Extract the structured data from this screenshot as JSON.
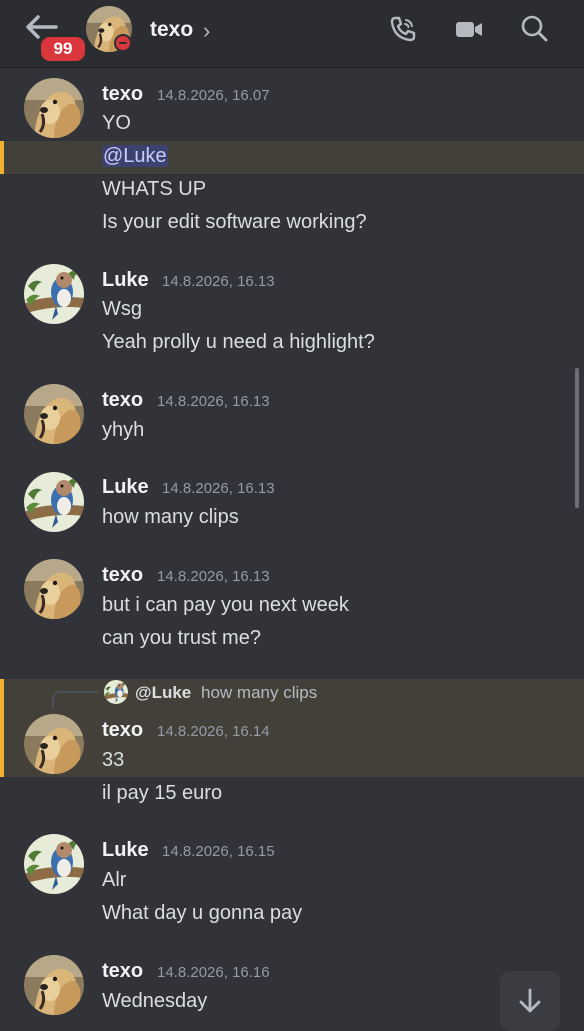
{
  "header": {
    "title": "texo",
    "chevron": "›",
    "unread_badge": "99",
    "status": "do-not-disturb",
    "icons": [
      "back-arrow-icon",
      "call-icon",
      "video-icon",
      "search-icon"
    ]
  },
  "colors": {
    "background": "#313338",
    "header": "#2b2d31",
    "highlight": "#43403a",
    "highlight_bar": "#f0b232",
    "badge": "#da373c"
  },
  "messages": [
    {
      "author": "texo",
      "time": "14.8.2026, 16.07",
      "lines": [
        "YO",
        "@Luke",
        "WHATS UP",
        "Is your edit software working?"
      ]
    },
    {
      "author": "Luke",
      "time": "14.8.2026, 16.13",
      "lines": [
        "Wsg",
        "Yeah prolly u need a highlight?"
      ]
    },
    {
      "author": "texo",
      "time": "14.8.2026, 16.13",
      "lines": [
        "yhyh"
      ]
    },
    {
      "author": "Luke",
      "time": "14.8.2026, 16.13",
      "lines": [
        "how many clips"
      ]
    },
    {
      "author": "texo",
      "time": "14.8.2026, 16.13",
      "lines": [
        "but i can pay you next week",
        "can you trust me?"
      ]
    },
    {
      "author": "texo",
      "time": "14.8.2026, 16.14",
      "reply": {
        "author": "@Luke",
        "text": "how many clips"
      },
      "lines": [
        "33",
        "il pay 15 euro"
      ]
    },
    {
      "author": "Luke",
      "time": "14.8.2026, 16.15",
      "lines": [
        "Alr",
        "What day u gonna pay"
      ]
    },
    {
      "author": "texo",
      "time": "14.8.2026, 16.16",
      "lines": [
        "Wednesday"
      ]
    }
  ]
}
